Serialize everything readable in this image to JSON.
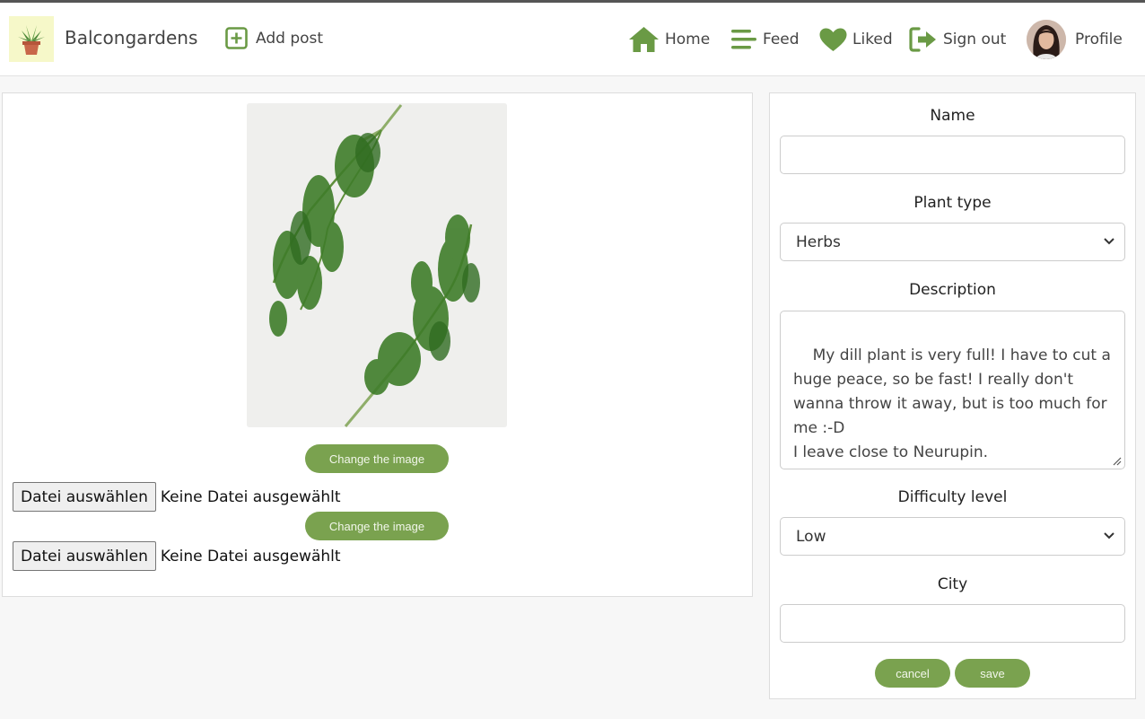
{
  "header": {
    "brand": "Balcongardens",
    "add_post": "Add post",
    "nav": {
      "home": "Home",
      "feed": "Feed",
      "liked": "Liked",
      "sign_out": "Sign out",
      "profile": "Profile"
    }
  },
  "media": {
    "change_image_1": "Change the image",
    "change_image_2": "Change the image",
    "file_button_1": "Datei auswählen",
    "file_status_1": "Keine Datei ausgewählt",
    "file_button_2": "Datei auswählen",
    "file_status_2": "Keine Datei ausgewählt"
  },
  "form": {
    "name_label": "Name",
    "name_value": "",
    "plant_type_label": "Plant type",
    "plant_type_value": "Herbs",
    "description_label": "Description",
    "description_value": "My dill plant is very full! I have to cut a huge peace, so be fast! I really don't wanna throw it away, but is too much for me :-D\nI leave close to Neurupin.",
    "difficulty_label": "Difficulty level",
    "difficulty_value": "Low",
    "city_label": "City",
    "city_value": "",
    "cancel": "cancel",
    "save": "save"
  },
  "colors": {
    "accent": "#7aa24f",
    "logo_bg": "#f6f8c9",
    "page_bg": "#f7f7f7"
  },
  "icons": [
    "plant-pot-logo-icon",
    "plus-square-icon",
    "home-icon",
    "menu-lines-icon",
    "heart-icon",
    "sign-out-icon",
    "chevron-down-icon"
  ]
}
